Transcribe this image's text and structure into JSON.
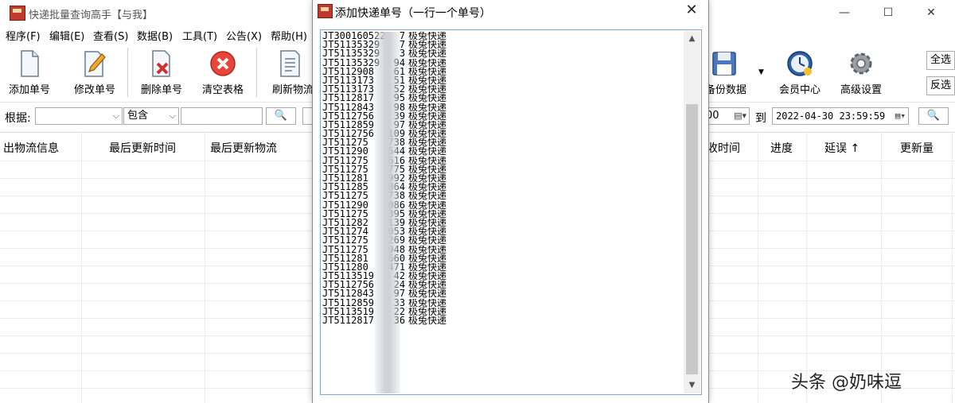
{
  "main_window": {
    "title": "快递批量查询高手【与我】",
    "controls": {
      "minimize": "—",
      "maximize": "☐",
      "close": "✕"
    },
    "menu": [
      "程序(F)",
      "编辑(E)",
      "查看(S)",
      "数据(B)",
      "工具(T)",
      "公告(X)",
      "帮助(H)"
    ],
    "toolbar": {
      "add": "添加单号",
      "edit": "修改单号",
      "delete": "删除单号",
      "clear": "清空表格",
      "refresh": "刷新物流",
      "backup": "备份数据",
      "member": "会员中心",
      "advanced": "高级设置",
      "select_all": "全选",
      "invert": "反选"
    },
    "filter": {
      "label": "根据:",
      "field_value": "",
      "mode_value": "包含",
      "search_value": "",
      "date_from_tail": "00",
      "to_label": "到",
      "date_to": "2022-04-30 23:59:59"
    },
    "columns": [
      "出物流信息",
      "最后更新时间",
      "最后更新物流",
      "收时间",
      "进度",
      "延误 ↑",
      "更新量"
    ]
  },
  "dialog": {
    "title": "添加快递单号（一行一个单号）",
    "close": "✕",
    "lines": [
      [
        "JT300160522",
        "7",
        "极兔快递"
      ],
      [
        "JT51135329",
        "7",
        "极兔快递"
      ],
      [
        "JT51135329",
        "3",
        "极兔快递"
      ],
      [
        "JT51135329",
        "94",
        "极兔快递"
      ],
      [
        "JT5112908",
        "61",
        "极兔快递"
      ],
      [
        "JT5113173",
        "51",
        "极兔快递"
      ],
      [
        "JT5113173",
        "52",
        "极兔快递"
      ],
      [
        "JT5112817",
        "95",
        "极兔快递"
      ],
      [
        "JT5112843",
        "98",
        "极兔快递"
      ],
      [
        "JT5112756",
        "39",
        "极兔快递"
      ],
      [
        "JT5112859",
        "97",
        "极兔快递"
      ],
      [
        "JT5112756",
        "109",
        "极兔快递"
      ],
      [
        "JT511275",
        "738",
        "极兔快递"
      ],
      [
        "JT511290",
        "544",
        "极兔快递"
      ],
      [
        "JT511275",
        "616",
        "极兔快递"
      ],
      [
        "JT511275",
        "775",
        "极兔快递"
      ],
      [
        "JT511281",
        "992",
        "极兔快递"
      ],
      [
        "JT511285",
        "864",
        "极兔快递"
      ],
      [
        "JT511275",
        "738",
        "极兔快递"
      ],
      [
        "JT511290",
        "086",
        "极兔快递"
      ],
      [
        "JT511275",
        "395",
        "极兔快递"
      ],
      [
        "JT511282",
        "139",
        "极兔快递"
      ],
      [
        "JT511274",
        "053",
        "极兔快递"
      ],
      [
        "JT511275",
        "269",
        "极兔快递"
      ],
      [
        "JT511275",
        "948",
        "极兔快递"
      ],
      [
        "JT511281",
        "660",
        "极兔快递"
      ],
      [
        "JT511280",
        "471",
        "极兔快递"
      ],
      [
        "JT5113519",
        "42",
        "极兔快递"
      ],
      [
        "JT5112756",
        "24",
        "极兔快递"
      ],
      [
        "JT5112843",
        "97",
        "极兔快递"
      ],
      [
        "JT5112859",
        "33",
        "极兔快递"
      ],
      [
        "JT5113519",
        "22",
        "极兔快递"
      ],
      [
        "JT5112817",
        "36",
        "极兔快递"
      ]
    ]
  },
  "watermark": "头条 @奶味逗",
  "colors": {
    "accent": "#7aa7d6",
    "icon_red": "#c0392b"
  }
}
